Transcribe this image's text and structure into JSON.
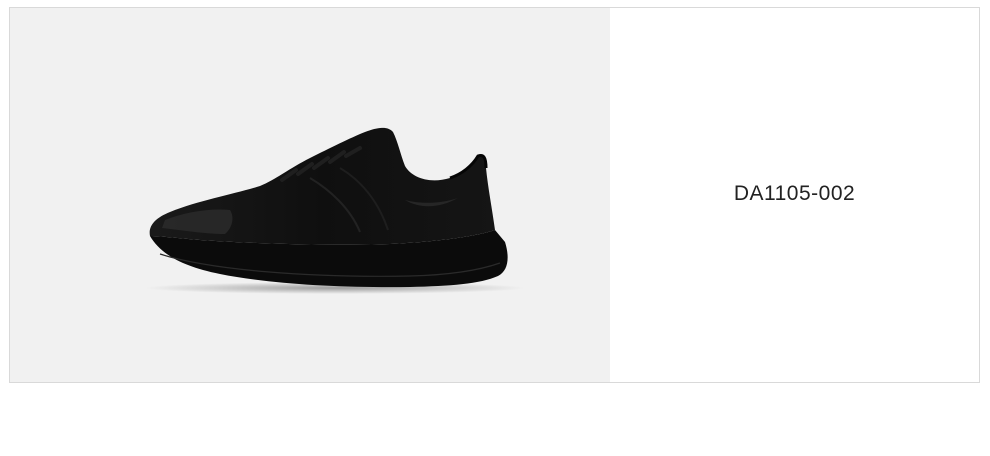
{
  "product": {
    "code": "DA1105-002",
    "image_subject": "shoe-image",
    "colors": {
      "image_background": "#f1f1f1",
      "card_border": "#d9d9d9",
      "shoe": "#111111"
    }
  }
}
